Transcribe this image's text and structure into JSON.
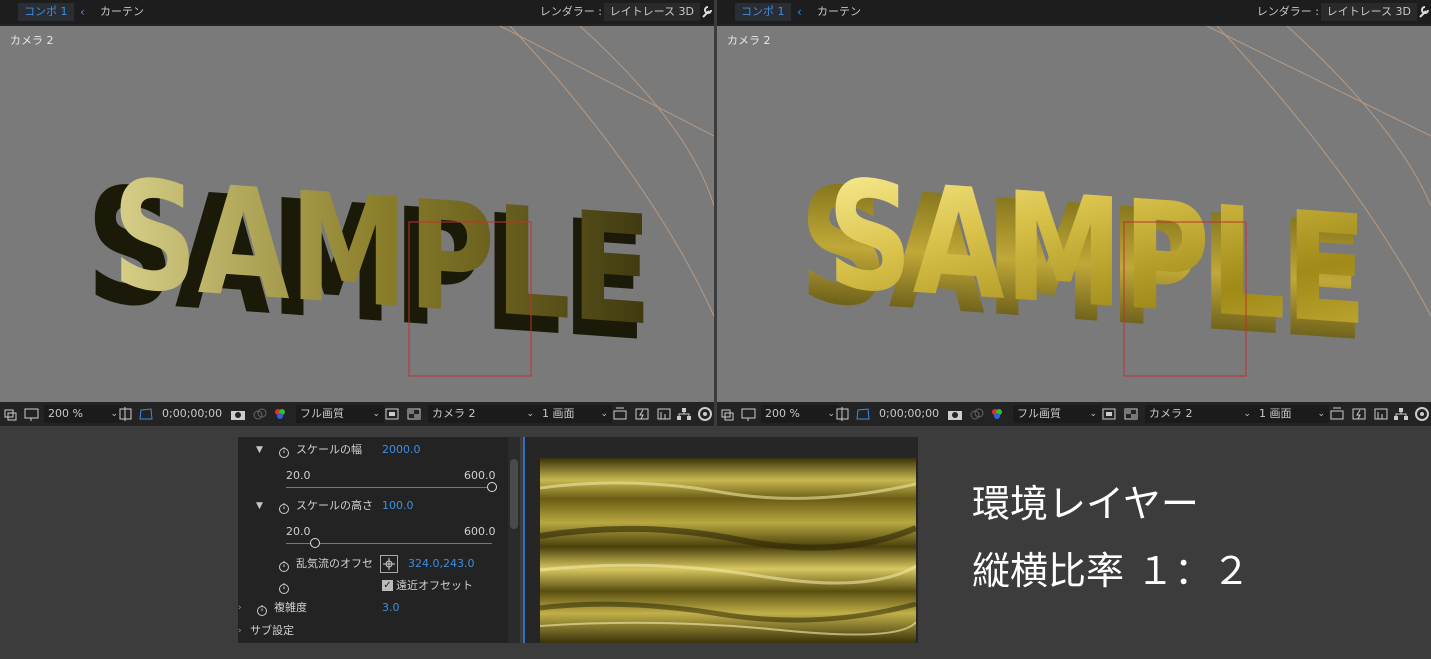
{
  "panels": [
    {
      "id": "left",
      "tab_active": "コンポ 1",
      "tab_other": "カーテン",
      "renderer_label": "レンダラー :",
      "renderer_value": "レイトレース 3D",
      "camera_label": "カメラ 2",
      "scene_text": "SAMPLE",
      "toolbar": {
        "zoom": "200 %",
        "timecode": "0;00;00;00",
        "resolution": "フル画質",
        "camera": "カメラ 2",
        "views": "1 画面"
      }
    },
    {
      "id": "right",
      "tab_active": "コンポ 1",
      "tab_other": "カーテン",
      "renderer_label": "レンダラー :",
      "renderer_value": "レイトレース 3D",
      "camera_label": "カメラ 2",
      "scene_text": "SAMPLE",
      "toolbar": {
        "zoom": "200 %",
        "timecode": "0;00;00;00",
        "resolution": "フル画質",
        "camera": "カメラ 2",
        "views": "1 画面"
      }
    }
  ],
  "effect_controls": {
    "scale_width": {
      "label": "スケールの幅",
      "value": "2000.0",
      "slider_min": "20.0",
      "slider_max": "600.0",
      "slider_fraction": 1.0
    },
    "scale_height": {
      "label": "スケールの高さ",
      "value": "100.0",
      "slider_min": "20.0",
      "slider_max": "600.0",
      "slider_fraction": 0.14
    },
    "turbulence_offset": {
      "label": "乱気流のオフセ",
      "value": "324.0,243.0"
    },
    "perspective_offset": {
      "label": "遠近オフセット",
      "checked": true
    },
    "complexity": {
      "label": "複雑度",
      "value": "3.0"
    },
    "sub_settings": {
      "label": "サブ設定"
    }
  },
  "caption": {
    "line1": "環境レイヤー",
    "line2": "縦横比率 １：２"
  },
  "colors": {
    "accent_blue": "#3d8fe0",
    "viewport_bg": "#7a7a7a",
    "gold": "#c9b445"
  }
}
